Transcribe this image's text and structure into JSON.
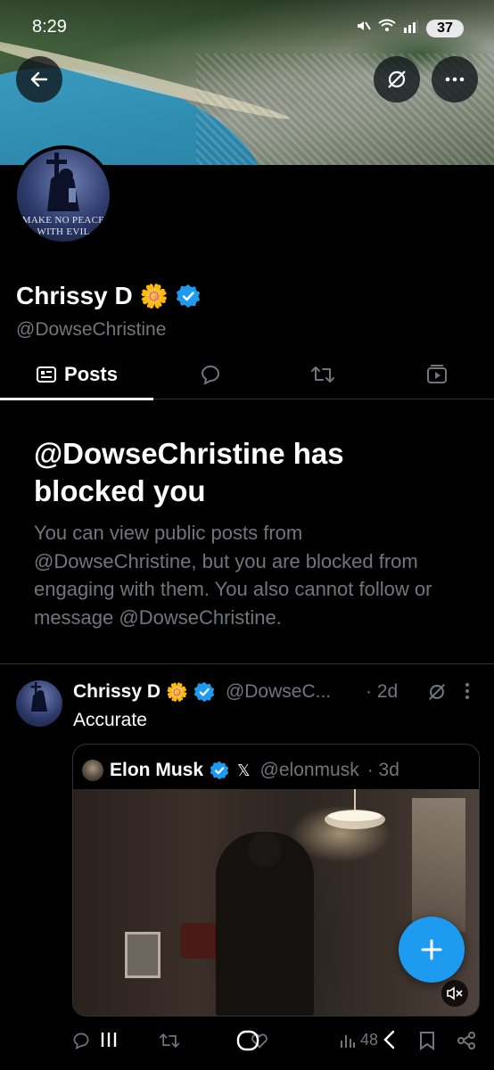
{
  "status_bar": {
    "time": "8:29",
    "battery": "37"
  },
  "profile": {
    "display_name": "Chrissy D",
    "name_emoji": "🌼",
    "handle": "@DowseChristine",
    "avatar_text_line1": "MAKE NO PEACE",
    "avatar_text_line2": "WITH EVIL"
  },
  "tabs": [
    {
      "label": "Posts",
      "active": true
    },
    {
      "icon": "reply-icon"
    },
    {
      "icon": "retweet-icon"
    },
    {
      "icon": "media-icon"
    }
  ],
  "blocked": {
    "title": "@DowseChristine has blocked you",
    "body": "You can view public posts from @DowseChristine, but you are blocked from engaging with them. You also cannot follow or message @DowseChristine."
  },
  "post": {
    "name": "Chrissy D",
    "emoji": "🌼",
    "handle": "@DowseC...",
    "time": "· 2d",
    "text": "Accurate",
    "quote": {
      "name": "Elon Musk",
      "x_badge": "𝕏",
      "handle": "@elonmusk",
      "time": "· 3d"
    },
    "actions": {
      "views": "48"
    }
  },
  "colors": {
    "accent": "#1d9bf0",
    "muted": "#71767b",
    "divider": "#2f3336"
  }
}
